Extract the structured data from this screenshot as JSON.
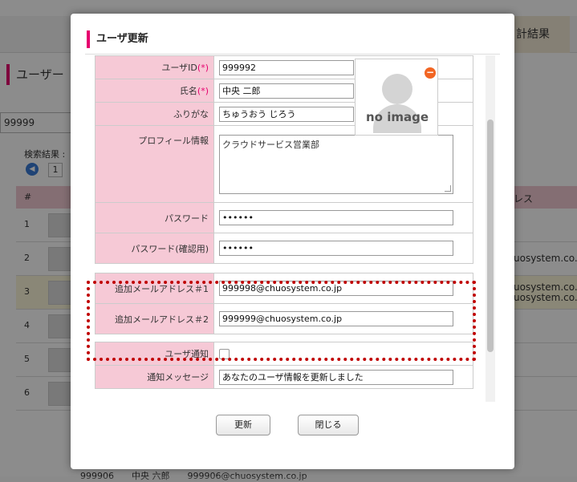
{
  "background": {
    "tab_right": "計結果",
    "page_title": "ユーザー",
    "search_value": "99999",
    "results_label": "検索結果 :",
    "page_number": "1",
    "table_header_num": "#",
    "table_header_email": "レス",
    "rows": [
      {
        "num": "1",
        "email": ""
      },
      {
        "num": "2",
        "email": "uosystem.co."
      },
      {
        "num": "3",
        "email": "uosystem.co.\nuosystem.co."
      },
      {
        "num": "4",
        "email": ""
      },
      {
        "num": "5",
        "email": ""
      },
      {
        "num": "6",
        "email": ""
      }
    ],
    "last_row_text": "999906　　中央 六郎　　999906@chuosystem.co.jp"
  },
  "modal": {
    "title": "ユーザ更新",
    "fields": {
      "user_id_label": "ユーザID",
      "user_id_value": "999992",
      "name_label": "氏名",
      "name_value": "中央 二郎",
      "furigana_label": "ふりがな",
      "furigana_value": "ちゅうおう じろう",
      "profile_label": "プロフィール情報",
      "profile_value": "クラウドサービス営業部",
      "password_label": "パスワード",
      "password_value": "••••••",
      "password_confirm_label": "パスワード(確認用)",
      "password_confirm_value": "••••••",
      "email1_label": "追加メールアドレス＃1",
      "email1_value": "999998@chuosystem.co.jp",
      "email2_label": "追加メールアドレス＃2",
      "email2_value": "999999@chuosystem.co.jp",
      "notify_label": "ユーザ通知",
      "notify_msg_label": "通知メッセージ",
      "notify_msg_value": "あなたのユーザ情報を更新しました"
    },
    "required_mark": "(*)",
    "avatar_text": "no image",
    "delete_icon": "−",
    "buttons": {
      "update": "更新",
      "close": "閉じる"
    }
  },
  "colors": {
    "accent": "#e6006e",
    "label_bg": "#f6c9d6",
    "highlight": "#c00000"
  }
}
